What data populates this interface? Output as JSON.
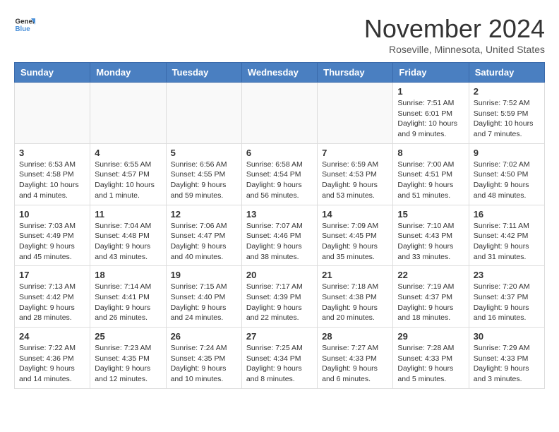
{
  "header": {
    "logo_general": "General",
    "logo_blue": "Blue",
    "month_year": "November 2024",
    "location": "Roseville, Minnesota, United States"
  },
  "days_of_week": [
    "Sunday",
    "Monday",
    "Tuesday",
    "Wednesday",
    "Thursday",
    "Friday",
    "Saturday"
  ],
  "weeks": [
    [
      {
        "day": "",
        "info": ""
      },
      {
        "day": "",
        "info": ""
      },
      {
        "day": "",
        "info": ""
      },
      {
        "day": "",
        "info": ""
      },
      {
        "day": "",
        "info": ""
      },
      {
        "day": "1",
        "info": "Sunrise: 7:51 AM\nSunset: 6:01 PM\nDaylight: 10 hours and 9 minutes."
      },
      {
        "day": "2",
        "info": "Sunrise: 7:52 AM\nSunset: 5:59 PM\nDaylight: 10 hours and 7 minutes."
      }
    ],
    [
      {
        "day": "3",
        "info": "Sunrise: 6:53 AM\nSunset: 4:58 PM\nDaylight: 10 hours and 4 minutes."
      },
      {
        "day": "4",
        "info": "Sunrise: 6:55 AM\nSunset: 4:57 PM\nDaylight: 10 hours and 1 minute."
      },
      {
        "day": "5",
        "info": "Sunrise: 6:56 AM\nSunset: 4:55 PM\nDaylight: 9 hours and 59 minutes."
      },
      {
        "day": "6",
        "info": "Sunrise: 6:58 AM\nSunset: 4:54 PM\nDaylight: 9 hours and 56 minutes."
      },
      {
        "day": "7",
        "info": "Sunrise: 6:59 AM\nSunset: 4:53 PM\nDaylight: 9 hours and 53 minutes."
      },
      {
        "day": "8",
        "info": "Sunrise: 7:00 AM\nSunset: 4:51 PM\nDaylight: 9 hours and 51 minutes."
      },
      {
        "day": "9",
        "info": "Sunrise: 7:02 AM\nSunset: 4:50 PM\nDaylight: 9 hours and 48 minutes."
      }
    ],
    [
      {
        "day": "10",
        "info": "Sunrise: 7:03 AM\nSunset: 4:49 PM\nDaylight: 9 hours and 45 minutes."
      },
      {
        "day": "11",
        "info": "Sunrise: 7:04 AM\nSunset: 4:48 PM\nDaylight: 9 hours and 43 minutes."
      },
      {
        "day": "12",
        "info": "Sunrise: 7:06 AM\nSunset: 4:47 PM\nDaylight: 9 hours and 40 minutes."
      },
      {
        "day": "13",
        "info": "Sunrise: 7:07 AM\nSunset: 4:46 PM\nDaylight: 9 hours and 38 minutes."
      },
      {
        "day": "14",
        "info": "Sunrise: 7:09 AM\nSunset: 4:45 PM\nDaylight: 9 hours and 35 minutes."
      },
      {
        "day": "15",
        "info": "Sunrise: 7:10 AM\nSunset: 4:43 PM\nDaylight: 9 hours and 33 minutes."
      },
      {
        "day": "16",
        "info": "Sunrise: 7:11 AM\nSunset: 4:42 PM\nDaylight: 9 hours and 31 minutes."
      }
    ],
    [
      {
        "day": "17",
        "info": "Sunrise: 7:13 AM\nSunset: 4:42 PM\nDaylight: 9 hours and 28 minutes."
      },
      {
        "day": "18",
        "info": "Sunrise: 7:14 AM\nSunset: 4:41 PM\nDaylight: 9 hours and 26 minutes."
      },
      {
        "day": "19",
        "info": "Sunrise: 7:15 AM\nSunset: 4:40 PM\nDaylight: 9 hours and 24 minutes."
      },
      {
        "day": "20",
        "info": "Sunrise: 7:17 AM\nSunset: 4:39 PM\nDaylight: 9 hours and 22 minutes."
      },
      {
        "day": "21",
        "info": "Sunrise: 7:18 AM\nSunset: 4:38 PM\nDaylight: 9 hours and 20 minutes."
      },
      {
        "day": "22",
        "info": "Sunrise: 7:19 AM\nSunset: 4:37 PM\nDaylight: 9 hours and 18 minutes."
      },
      {
        "day": "23",
        "info": "Sunrise: 7:20 AM\nSunset: 4:37 PM\nDaylight: 9 hours and 16 minutes."
      }
    ],
    [
      {
        "day": "24",
        "info": "Sunrise: 7:22 AM\nSunset: 4:36 PM\nDaylight: 9 hours and 14 minutes."
      },
      {
        "day": "25",
        "info": "Sunrise: 7:23 AM\nSunset: 4:35 PM\nDaylight: 9 hours and 12 minutes."
      },
      {
        "day": "26",
        "info": "Sunrise: 7:24 AM\nSunset: 4:35 PM\nDaylight: 9 hours and 10 minutes."
      },
      {
        "day": "27",
        "info": "Sunrise: 7:25 AM\nSunset: 4:34 PM\nDaylight: 9 hours and 8 minutes."
      },
      {
        "day": "28",
        "info": "Sunrise: 7:27 AM\nSunset: 4:33 PM\nDaylight: 9 hours and 6 minutes."
      },
      {
        "day": "29",
        "info": "Sunrise: 7:28 AM\nSunset: 4:33 PM\nDaylight: 9 hours and 5 minutes."
      },
      {
        "day": "30",
        "info": "Sunrise: 7:29 AM\nSunset: 4:33 PM\nDaylight: 9 hours and 3 minutes."
      }
    ]
  ]
}
